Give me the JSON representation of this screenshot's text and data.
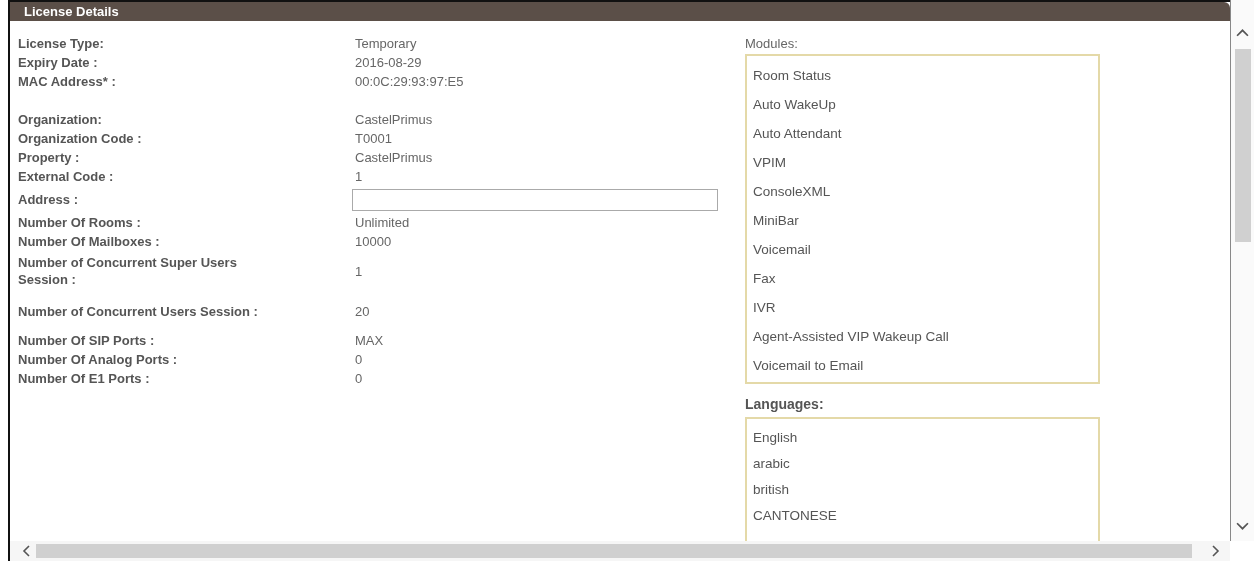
{
  "panel": {
    "title": "License Details"
  },
  "field_groups": [
    [
      {
        "label": "License Type:",
        "kind": "text",
        "value": "Temporary"
      },
      {
        "label": "Expiry Date :",
        "kind": "text",
        "value": "2016-08-29"
      },
      {
        "label": "MAC Address* :",
        "kind": "text",
        "value": "00:0C:29:93:97:E5"
      }
    ],
    [
      {
        "label": "Organization:",
        "kind": "text",
        "value": "CastelPrimus"
      },
      {
        "label": "Organization Code :",
        "kind": "text",
        "value": "T0001"
      },
      {
        "label": "Property :",
        "kind": "text",
        "value": "CastelPrimus"
      },
      {
        "label": "External Code :",
        "kind": "text",
        "value": "1"
      },
      {
        "label": "Address :",
        "kind": "field"
      },
      {
        "label": "Number Of Rooms :",
        "kind": "text",
        "value": "Unlimited"
      },
      {
        "label": "Number Of Mailboxes :",
        "kind": "text",
        "value": "10000"
      },
      {
        "label": "Number of Concurrent Super Users Session  :",
        "kind": "text",
        "value": "1"
      },
      {
        "label": "Number of Concurrent Users Session  :",
        "kind": "text",
        "value": "20"
      },
      {
        "label": "Number Of SIP Ports :",
        "kind": "text",
        "value": "MAX"
      },
      {
        "label": "Number Of Analog Ports :",
        "kind": "text",
        "value": "0"
      },
      {
        "label": "Number Of E1 Ports :",
        "kind": "text",
        "value": "0"
      }
    ]
  ],
  "modules": {
    "label": "Modules:",
    "items": [
      "Room Status",
      "Auto WakeUp",
      "Auto Attendant",
      "VPIM",
      "ConsoleXML",
      "MiniBar",
      "Voicemail",
      "Fax",
      "IVR",
      "Agent-Assisted VIP Wakeup Call",
      "Voicemail to Email"
    ]
  },
  "languages": {
    "label": "Languages:",
    "items": [
      "English",
      "arabic",
      "british",
      "CANTONESE"
    ]
  }
}
